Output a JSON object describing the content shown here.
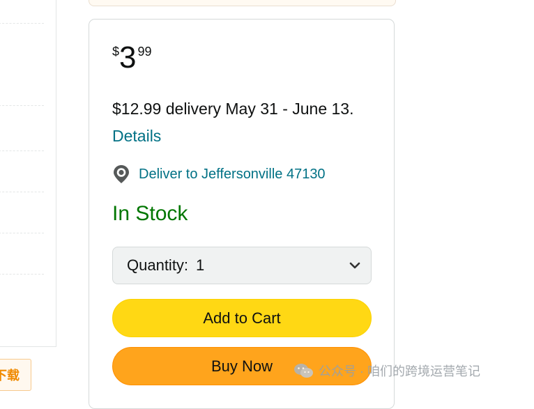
{
  "sidebar": {
    "download_label": "下载"
  },
  "price": {
    "symbol": "$",
    "whole": "3",
    "fraction": "99"
  },
  "delivery": {
    "text": "$12.99 delivery May 31 - June 13.",
    "details_link": "Details"
  },
  "location": {
    "icon": "location-pin-icon",
    "label": "Deliver to Jeffersonville 47130"
  },
  "availability": {
    "label": "In Stock",
    "color": "#007600"
  },
  "quantity": {
    "label": "Quantity:",
    "value": "1"
  },
  "buttons": {
    "add_to_cart": "Add to Cart",
    "buy_now": "Buy Now"
  },
  "colors": {
    "add_to_cart_bg": "#ffd814",
    "buy_now_bg": "#ffa41c",
    "link": "#007185"
  },
  "watermark": {
    "text": "公众号 · 咱们的跨境运营笔记",
    "icon": "wechat-icon"
  }
}
